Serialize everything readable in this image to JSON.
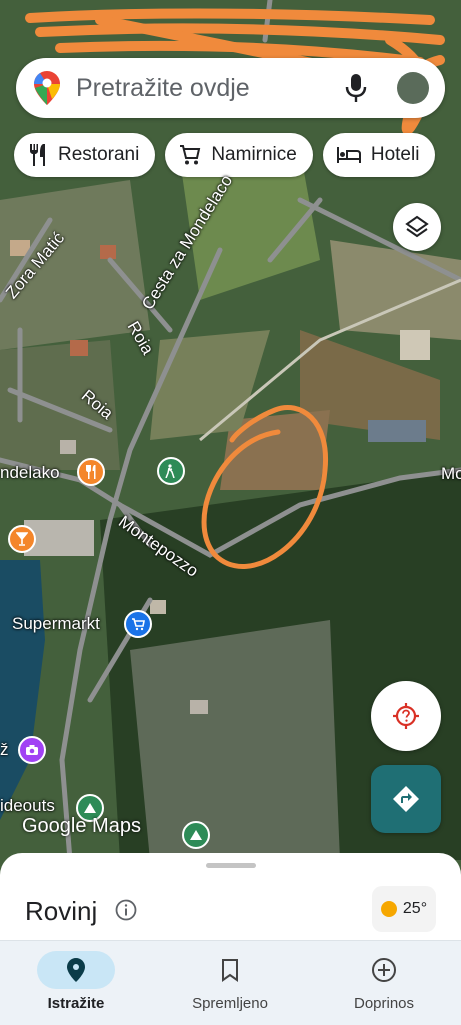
{
  "search": {
    "placeholder": "Pretražite ovdje"
  },
  "chips": [
    {
      "label": "Restorani",
      "icon": "restaurant-icon"
    },
    {
      "label": "Namirnice",
      "icon": "cart-icon"
    },
    {
      "label": "Hoteli",
      "icon": "bed-icon"
    }
  ],
  "map_labels": {
    "cesta": "Cesta za Mondelaco",
    "zora": "Zora Matić",
    "roia1": "Roia",
    "roia2": "Roia",
    "mondelako": "ndelako",
    "montepozzo": "Montepozzo",
    "supermarkt": "Supermarkt",
    "hideouts": "ideouts",
    "mo": "Mo",
    "z": "ž"
  },
  "watermark": "Google Maps",
  "sheet": {
    "place": "Rovinj",
    "temperature": "25°"
  },
  "nav": [
    {
      "label": "Istražite",
      "icon": "explore-pin-icon",
      "active": true
    },
    {
      "label": "Spremljeno",
      "icon": "bookmark-icon",
      "active": false
    },
    {
      "label": "Doprinos",
      "icon": "add-circle-icon",
      "active": false
    }
  ],
  "colors": {
    "accent_teal": "#1f6f74",
    "annotation_orange": "#f08a3c",
    "active_pill": "#c9e6f6"
  }
}
